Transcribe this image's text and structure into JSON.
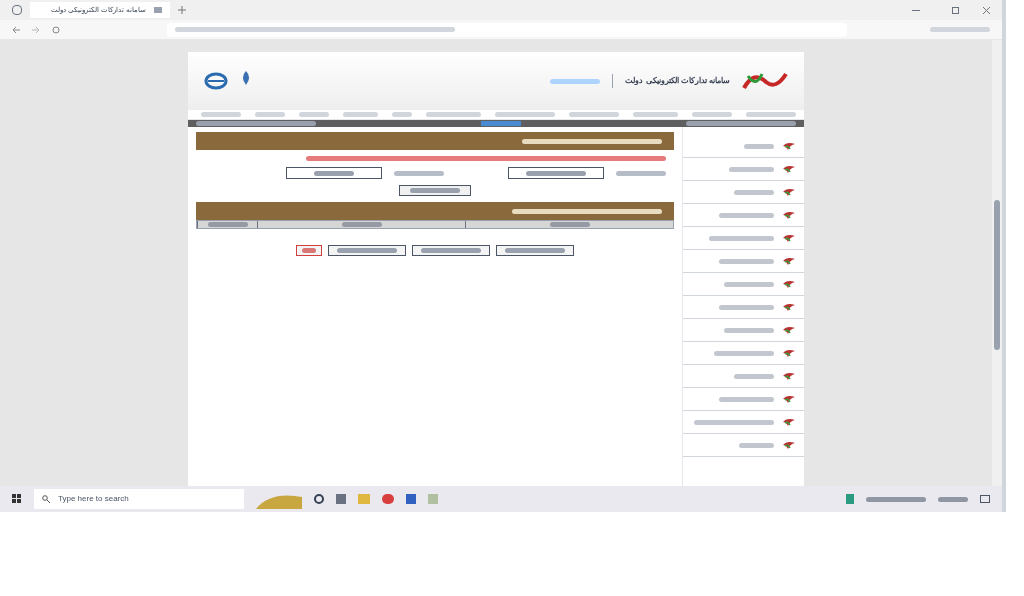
{
  "browser": {
    "tab_title": "سامانه تدارکات الکترونیکی دولت"
  },
  "header": {
    "logo_title": "سامانه تدارکات الکترونیکی دولت"
  },
  "nav": {
    "items": [
      {
        "kind": "link"
      },
      {
        "kind": "link"
      },
      {
        "kind": "link"
      },
      {
        "kind": "link"
      },
      {
        "kind": "link"
      },
      {
        "kind": "link"
      },
      {
        "kind": "link"
      },
      {
        "kind": "link"
      },
      {
        "kind": "link"
      },
      {
        "kind": "link"
      },
      {
        "kind": "link"
      }
    ]
  },
  "sidebar": {
    "items": [
      {
        "kind": "link"
      },
      {
        "kind": "link"
      },
      {
        "kind": "link"
      },
      {
        "kind": "link"
      },
      {
        "kind": "link"
      },
      {
        "kind": "link"
      },
      {
        "kind": "link"
      },
      {
        "kind": "link"
      },
      {
        "kind": "link"
      },
      {
        "kind": "link"
      },
      {
        "kind": "link"
      },
      {
        "kind": "link"
      },
      {
        "kind": "link"
      },
      {
        "kind": "link"
      }
    ]
  },
  "form": {
    "columns": [
      {
        "kind": "wide"
      },
      {
        "kind": "wide"
      },
      {
        "kind": "narrow"
      }
    ],
    "buttons": [
      {
        "kind": "normal"
      },
      {
        "kind": "normal"
      },
      {
        "kind": "normal"
      },
      {
        "kind": "danger"
      }
    ]
  },
  "taskbar": {
    "search_placeholder": "Type here to search"
  }
}
